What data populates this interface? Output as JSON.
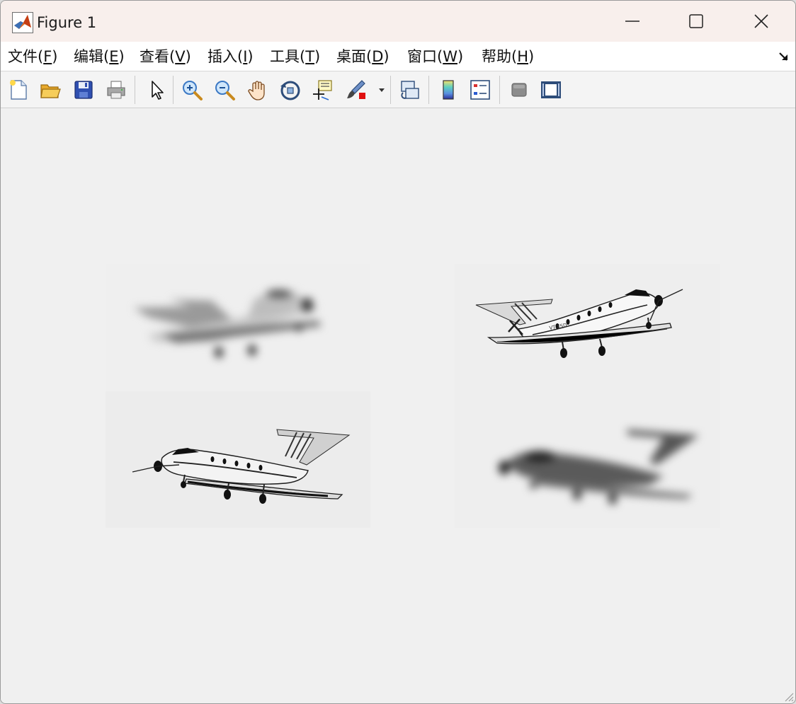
{
  "window": {
    "title": "Figure 1",
    "controls": {
      "minimize": "minimize",
      "maximize": "maximize",
      "close": "close"
    }
  },
  "menubar": {
    "items": [
      {
        "label": "文件(",
        "hotkey": "F",
        "suffix": ")"
      },
      {
        "label": "编辑(",
        "hotkey": "E",
        "suffix": ")"
      },
      {
        "label": "查看(",
        "hotkey": "V",
        "suffix": ")"
      },
      {
        "label": "插入(",
        "hotkey": "I",
        "suffix": ")"
      },
      {
        "label": "工具(",
        "hotkey": "T",
        "suffix": ")"
      },
      {
        "label": "桌面(",
        "hotkey": "D",
        "suffix": ")"
      },
      {
        "label": "窗口(",
        "hotkey": "W",
        "suffix": ")"
      },
      {
        "label": "帮助(",
        "hotkey": "H",
        "suffix": ")"
      }
    ]
  },
  "toolbar": {
    "icons": [
      "new-figure-icon",
      "open-file-icon",
      "save-icon",
      "print-icon",
      "select-arrow-icon",
      "zoom-in-icon",
      "zoom-out-icon",
      "pan-hand-icon",
      "rotate-3d-icon",
      "data-cursor-icon",
      "brush-icon",
      "brush-dropdown-icon",
      "link-plot-icon",
      "colorbar-icon",
      "legend-icon",
      "hide-plot-tools-icon",
      "show-plot-tools-icon"
    ]
  },
  "figure": {
    "subplots": [
      {
        "position": "top-left",
        "content": "blurred aircraft image",
        "blur": "strong"
      },
      {
        "position": "top-right",
        "content": "sharp aircraft image",
        "blur": "none"
      },
      {
        "position": "bottom-left",
        "content": "sharp aircraft image (mirrored)",
        "blur": "none"
      },
      {
        "position": "bottom-right",
        "content": "blurred aircraft image (mirrored, darker)",
        "blur": "strong"
      }
    ],
    "aircraft_registration": "VT-XSD"
  },
  "colors": {
    "titlebar": "#f8efec",
    "menubar": "#ffffff",
    "toolbar": "#f4f4f4",
    "figure_background": "#f0f0f0"
  }
}
